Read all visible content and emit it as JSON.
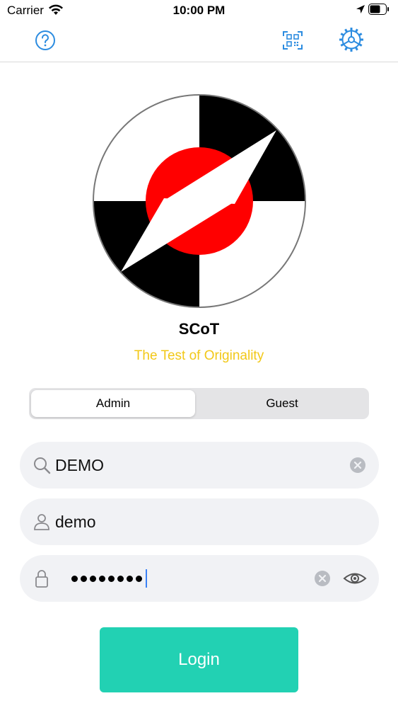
{
  "status_bar": {
    "carrier": "Carrier",
    "time": "10:00 PM"
  },
  "nav": {
    "help_icon": "question-circle-icon",
    "qr_icon": "qr-scan-icon",
    "settings_icon": "gear-icon"
  },
  "app": {
    "name": "SCoT",
    "tagline": "The Test of Originality",
    "tagline_color": "#f2c818"
  },
  "segment": {
    "options": [
      "Admin",
      "Guest"
    ],
    "selected": "Admin"
  },
  "fields": {
    "organization": {
      "value": "DEMO",
      "icon": "search-icon"
    },
    "username": {
      "value": "demo",
      "icon": "user-icon"
    },
    "password": {
      "masked_length": 8,
      "icon": "lock-icon"
    }
  },
  "login_button": {
    "label": "Login",
    "color": "#22d1b3"
  },
  "colors": {
    "accent": "#2c8ce0",
    "logo_red": "#ff0000"
  }
}
